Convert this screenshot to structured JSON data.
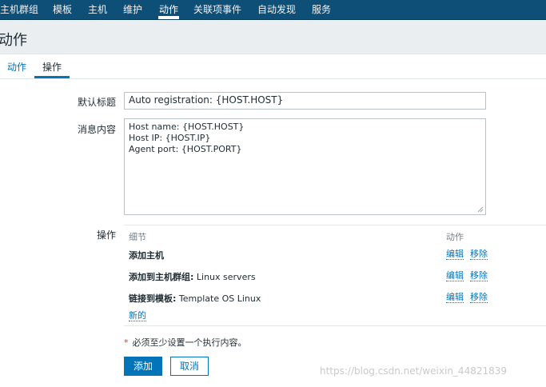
{
  "nav": {
    "items": [
      "主机群组",
      "模板",
      "主机",
      "维护",
      "动作",
      "关联项事件",
      "自动发现",
      "服务"
    ],
    "active_index": 4
  },
  "page": {
    "title": "动作"
  },
  "tabs": {
    "items": [
      "动作",
      "操作"
    ],
    "active_index": 1
  },
  "form": {
    "subject_label": "默认标题",
    "subject_value": "Auto registration: {HOST.HOST}",
    "message_label": "消息内容",
    "message_lines": [
      "Host name: {HOST.HOST}",
      "Host IP: {HOST.IP}",
      "Agent port: {HOST.PORT}"
    ],
    "operations_label": "操作"
  },
  "operations": {
    "header_details": "细节",
    "header_action": "动作",
    "rows": [
      {
        "bold": "添加主机",
        "rest": "",
        "edit": "编辑",
        "remove": "移除"
      },
      {
        "bold": "添加到主机群组:",
        "rest": " Linux servers",
        "edit": "编辑",
        "remove": "移除"
      },
      {
        "bold": "链接到模板:",
        "rest": " Template OS Linux",
        "edit": "编辑",
        "remove": "移除"
      }
    ],
    "new_link": "新的"
  },
  "requirement": {
    "star": "*",
    "text": "必须至少设置一个执行内容。"
  },
  "buttons": {
    "add": "添加",
    "cancel": "取消"
  },
  "watermark": "https://blog.csdn.net/weixin_44821839",
  "colors": {
    "nav_bg": "#0e4f78",
    "accent": "#0275b8",
    "required": "#e33734"
  }
}
